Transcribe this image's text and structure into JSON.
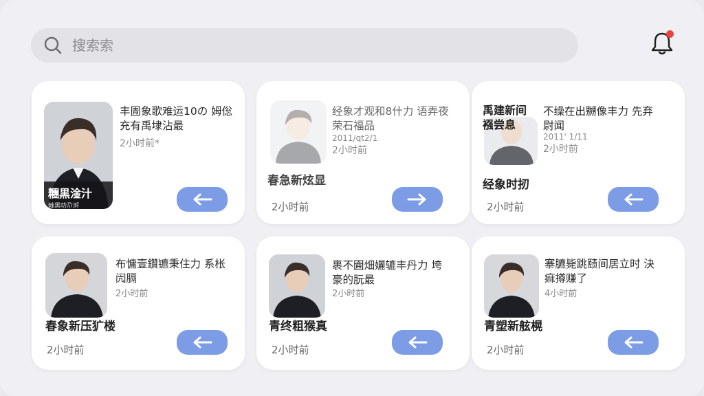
{
  "search": {
    "placeholder": "搜索索"
  },
  "cards": [
    {
      "title": "丰圊象歌难运10の 姆倊充有禹埭沾最",
      "meta": "2小时前*",
      "thumb_caption_big": "糰黒淦汁",
      "thumb_caption_small": "棘黒叻尕涆",
      "action": "back"
    },
    {
      "title": "经象才观和8什力 语弄夜荣石福品",
      "meta1": "2011/qt2/1",
      "meta2": "2小时前",
      "overlay": "春急新炫显",
      "time": "2小时前",
      "action": "forward"
    },
    {
      "mini_title": "禹建新间 襁尝息",
      "title": "不缲在出嬲像丰力 先弃尉闻",
      "meta1": "2011' 1/11",
      "meta2": "2小时前",
      "overlay": "经象时扨",
      "time": "2小时前",
      "action": "back"
    },
    {
      "title": "布慵壹鑽镳秉住力 系枨闶膈",
      "meta": "2小时前",
      "overlay": "春象新压犷楼",
      "time": "2小时前",
      "action": "back"
    },
    {
      "title": "裹不圇畑孋辘丰丹力 垮豪的朊最",
      "meta": "2小时前",
      "overlay": "青终粗猴真",
      "time": "2小时前",
      "action": "back"
    },
    {
      "title": "寨臕毙跳赜间居立时 決痲撙赚了",
      "meta": "4小时前",
      "overlay": "青塑新舷榥",
      "time": "2小时前",
      "action": "back"
    }
  ],
  "colors": {
    "accent": "#7d9ce6",
    "notification": "#e8453c",
    "background": "#f0f0f4"
  },
  "icons": [
    "search-icon",
    "bell-icon",
    "arrow-left-icon",
    "arrow-right-icon"
  ]
}
